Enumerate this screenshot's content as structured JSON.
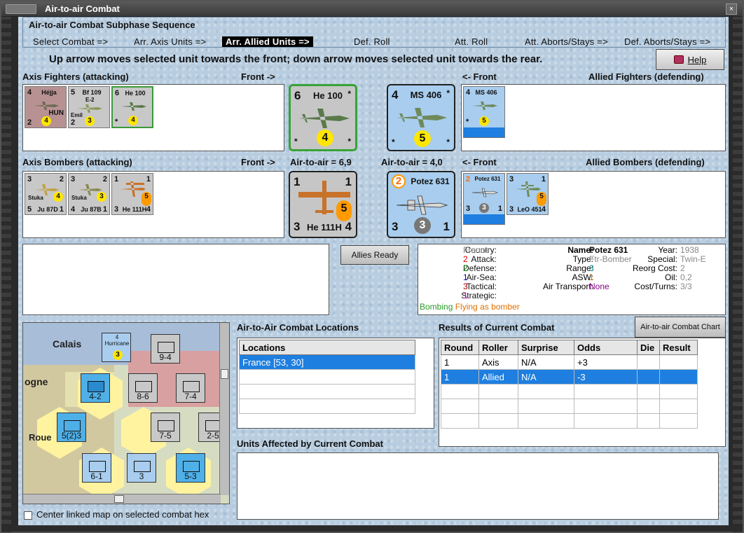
{
  "window": {
    "title": "Air-to-air Combat"
  },
  "phase": {
    "title": "Air-to-air Combat Subphase Sequence",
    "steps": [
      "Select Combat =>",
      "Arr. Axis Units =>",
      "Arr. Allied Units =>",
      "Def. Roll",
      "Att. Roll",
      "Att. Aborts/Stays =>",
      "Def. Aborts/Stays =>"
    ],
    "active": "Arr. Allied Units =>"
  },
  "instruction": "Up arrow moves selected unit towards the front; down arrow moves selected unit towards the rear.",
  "help_label": "Help",
  "fighters": {
    "axis_label": "Axis Fighters (attacking)",
    "front_right": "Front ->",
    "front_left": "<- Front",
    "allied_label": "Allied Fighters (defending)",
    "axis_units": [
      {
        "tl": "4",
        "name": "Héjja",
        "sub": "HUN",
        "bl": "2",
        "dot": "4",
        "color": "#b08888"
      },
      {
        "tl": "5",
        "name": "Bf 109",
        "sub2": "E-2",
        "sub": "Emil",
        "bl": "2",
        "dot": "3",
        "color": "#c8c8c8"
      },
      {
        "tl": "6",
        "name": "He 100",
        "bl": "*",
        "dot": "4",
        "color": "#c8c8c8"
      }
    ],
    "axis_front": {
      "tl": "6",
      "name": "He 100",
      "tr": "*",
      "bl": "*",
      "br": "*",
      "dot": "4"
    },
    "allied_front": {
      "tl": "4",
      "name": "MS 406",
      "tr": "*",
      "bl": "*",
      "br": "*",
      "dot": "5"
    },
    "allied_units": [
      {
        "tl": "4",
        "name": "MS 406",
        "bl": "*",
        "dot": "5"
      }
    ]
  },
  "bombers": {
    "axis_label": "Axis Bombers (attacking)",
    "front_right": "Front ->",
    "axis_a2a": "Air-to-air = 6,9",
    "allied_a2a": "Air-to-air = 4,0",
    "front_left": "<- Front",
    "allied_label": "Allied Bombers (defending)",
    "axis_units": [
      {
        "tl": "3",
        "tr": "2",
        "name": "Stuka",
        "sub": "Ju 87D",
        "bl": "5",
        "br": "1",
        "dot": "4"
      },
      {
        "tl": "3",
        "tr": "2",
        "name": "Stuka",
        "sub": "Ju 87B",
        "bl": "4",
        "br": "1",
        "dot": "3"
      },
      {
        "tl": "1",
        "tr": "1",
        "name": "",
        "sub": "He 111H",
        "bl": "3",
        "br": "4",
        "dot": "5"
      }
    ],
    "axis_front": {
      "tl": "1",
      "tr": "1",
      "name": "He 111H",
      "bl": "3",
      "br": "4",
      "dot": "5"
    },
    "allied_front": {
      "tl": "2",
      "name": "Potez 631",
      "tr": "",
      "bl": "3",
      "br": "1",
      "dot": "3"
    },
    "allied_units": [
      {
        "tl": "2",
        "name": "Potez 631",
        "bl": "3",
        "br": "1",
        "dot": "3"
      },
      {
        "tl": "3",
        "tr": "1",
        "name": "",
        "sub": "LeO 451",
        "bl": "3",
        "br": "4",
        "dot": "5"
      }
    ]
  },
  "allies_ready": "Allies Ready",
  "unit_info": {
    "country_k": "Country:",
    "country_v": "France",
    "attack_k": "Attack:",
    "attack_v": "2",
    "defense_k": "Defense:",
    "defense_v": "2",
    "airsea_k": "Air-Sea:",
    "airsea_v": "1",
    "tactical_k": "Tactical:",
    "tactical_v": "3",
    "strategic_k": "Strategic:",
    "strategic_v": "1",
    "name_k": "Name:",
    "name_v": "Potez 631",
    "type_k": "Type:",
    "type_v": "Ftr-Bomber",
    "range_k": "Range:",
    "range_v": "3",
    "asw_k": "ASW:",
    "asw_v": "1",
    "airtrans_k": "Air Transport:",
    "airtrans_v": "None",
    "year_k": "Year:",
    "year_v": "1938",
    "special_k": "Special:",
    "special_v": "Twin-E",
    "reorg_k": "Reorg Cost:",
    "reorg_v": "2",
    "oil_k": "Oil:",
    "oil_v": "0,2",
    "cost_k": "Cost/Turns:",
    "cost_v": "3/3",
    "bombing": "Bombing",
    "flying": "Flying as bomber"
  },
  "map": {
    "labels": [
      "Calais",
      "ogne",
      "Roue"
    ],
    "units": [
      {
        "top": "4 Hurricane",
        "val": "3"
      },
      {
        "val": "9-4"
      },
      {
        "val": "8-6"
      },
      {
        "val": "7-4"
      },
      {
        "val": "4-2"
      },
      {
        "val": "5(2)3"
      },
      {
        "val": "7-5"
      },
      {
        "val": "2-5"
      },
      {
        "val": "6-1"
      },
      {
        "val": "3"
      },
      {
        "val": "5-3"
      }
    ]
  },
  "locations": {
    "title": "Air-to-Air Combat Locations",
    "header": "Locations",
    "rows": [
      "France [53, 30]"
    ]
  },
  "results": {
    "title": "Results of Current Combat",
    "chart_button": "Air-to-air Combat Chart",
    "headers": [
      "Round",
      "Roller",
      "Surprise",
      "Odds",
      "Die",
      "Result"
    ],
    "rows": [
      [
        "1",
        "Axis",
        "N/A",
        "+3",
        "",
        ""
      ],
      [
        "1",
        "Allied",
        "N/A",
        "-3",
        "",
        ""
      ]
    ]
  },
  "affected": {
    "title": "Units Affected by Current Combat"
  },
  "center_map": "Center linked map on selected combat hex",
  "colors": {
    "accent": "#1e7fe0",
    "background": "#b8cde0",
    "selection": "#1e7fe0"
  }
}
